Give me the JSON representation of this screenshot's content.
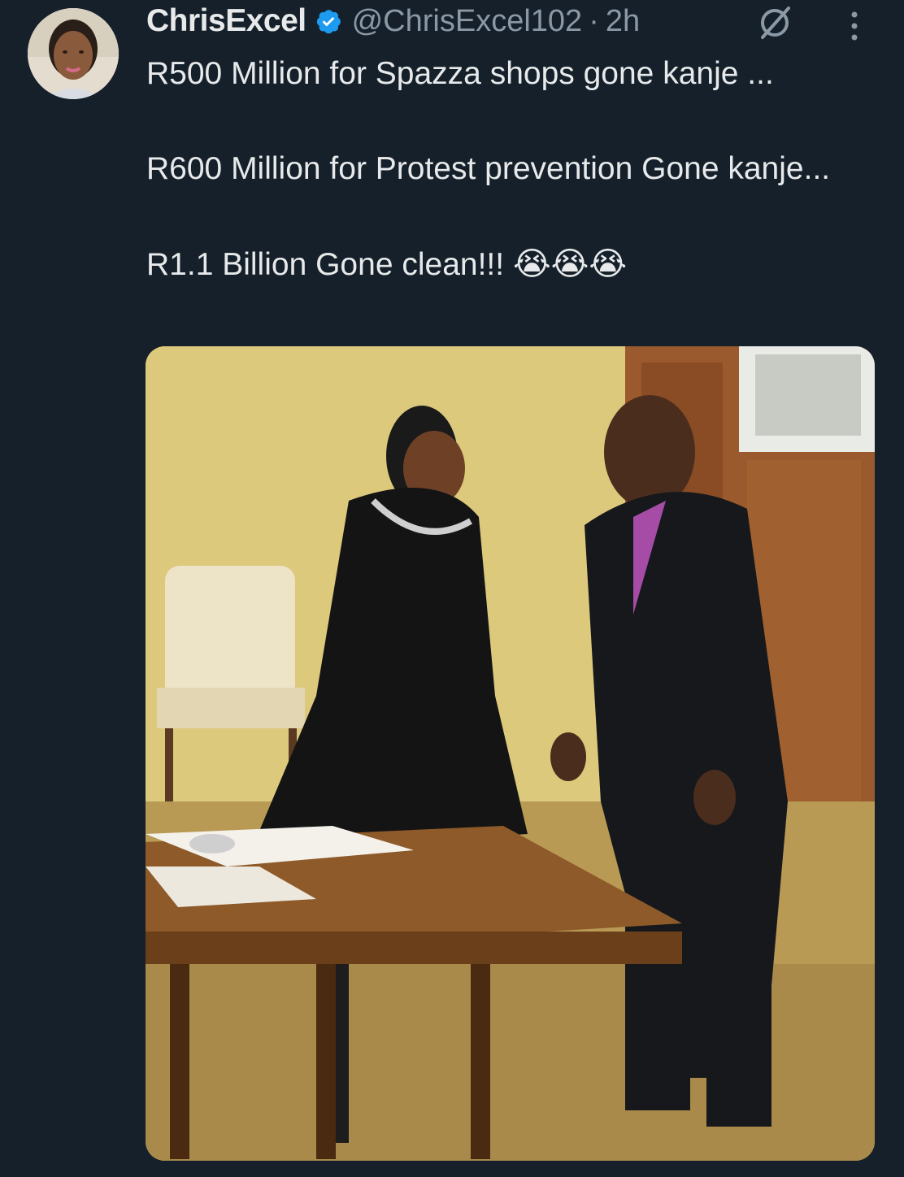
{
  "author": {
    "display_name": "ChrisExcel",
    "handle": "@ChrisExcel102",
    "separator": "·",
    "time": "2h",
    "verified": true
  },
  "tweet": {
    "line1": "R500 Million for Spazza shops gone kanje ...",
    "line2": "R600 Million for Protest prevention Gone kanje...",
    "line3": "R1.1 Billion Gone clean!!!",
    "emojis": "😭😭😭"
  },
  "icons": {
    "verified": "verified-badge-icon",
    "grok": "grok-icon",
    "more": "more-vertical-icon"
  },
  "colors": {
    "background": "#15202b",
    "text": "#e7e9ea",
    "secondary": "#8b98a5",
    "verified_blue": "#1d9bf0"
  }
}
